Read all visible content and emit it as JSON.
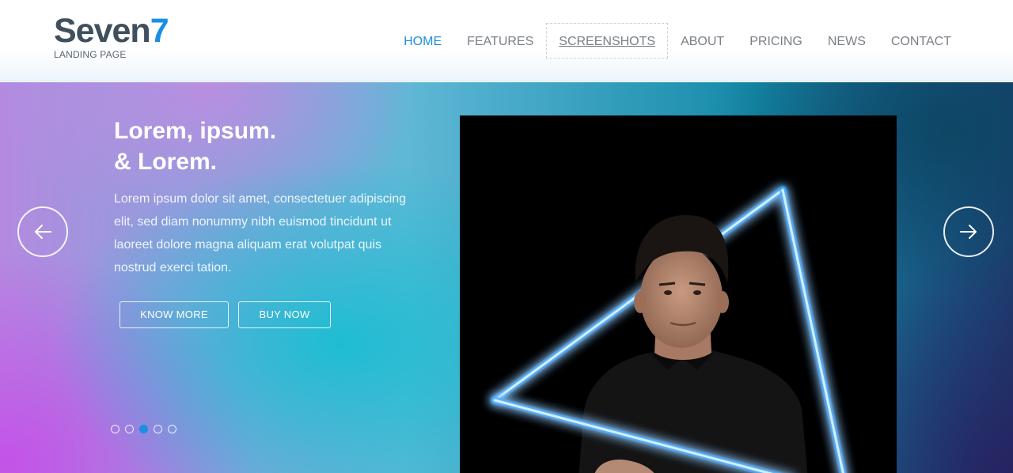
{
  "logo": {
    "name_main": "Seven",
    "name_accent": "7",
    "tagline": "LANDING PAGE"
  },
  "nav": {
    "items": [
      {
        "label": "HOME",
        "state": "active"
      },
      {
        "label": "FEATURES",
        "state": ""
      },
      {
        "label": "SCREENSHOTS",
        "state": "focused"
      },
      {
        "label": "ABOUT",
        "state": ""
      },
      {
        "label": "PRICING",
        "state": ""
      },
      {
        "label": "NEWS",
        "state": ""
      },
      {
        "label": "CONTACT",
        "state": ""
      }
    ]
  },
  "hero": {
    "title_line1": "Lorem, ipsum.",
    "title_line2": "& Lorem.",
    "text": "Lorem ipsum dolor sit amet, consectetuer adipiscing elit, sed diam nonummy nibh euismod tincidunt ut laoreet dolore magna aliquam erat volutpat quis nostrud exerci tation.",
    "know_more_label": "KNOW MORE",
    "buy_now_label": "BUY NOW",
    "prev_icon": "arrow-left-icon",
    "next_icon": "arrow-right-icon",
    "slide_count": 5,
    "active_slide": 3
  },
  "colors": {
    "accent": "#1a8fe3",
    "logo_dark": "#3f4f5e",
    "nav_text": "#7a7f85",
    "neon": "#3fb4ff"
  }
}
